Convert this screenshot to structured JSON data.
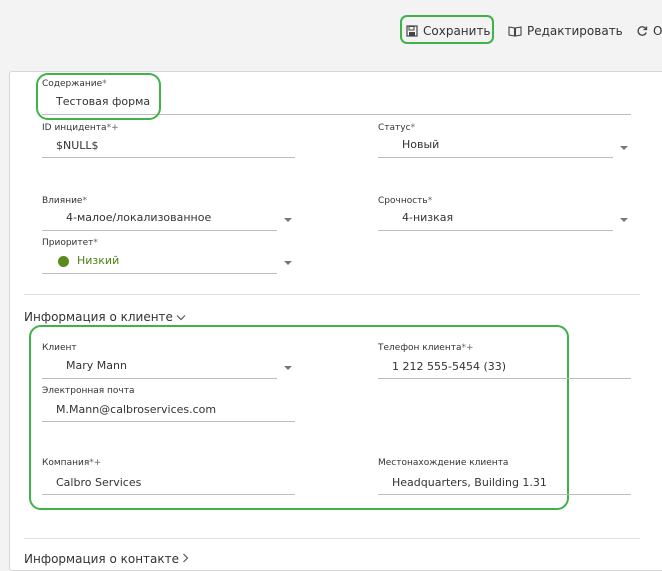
{
  "toolbar": {
    "save_label": "Сохранить",
    "edit_label": "Редактировать",
    "refresh_label": "О"
  },
  "form": {
    "summary": {
      "label": "Содержание",
      "value": "Тестовая форма"
    },
    "incident_id": {
      "label": "ID инцидента",
      "value": "$NULL$"
    },
    "status": {
      "label": "Статус",
      "value": "Новый"
    },
    "impact": {
      "label": "Влияние",
      "value": "4-малое/локализованное"
    },
    "urgency": {
      "label": "Срочность",
      "value": "4-низкая"
    },
    "priority": {
      "label": "Приоритет",
      "value": "Низкий",
      "color": "#5b8a1c"
    }
  },
  "client_section": {
    "title": "Информация о клиенте",
    "client": {
      "label": "Клиент",
      "value": "Mary Mann"
    },
    "phone": {
      "label": "Телефон клиента",
      "value": "1 212 555-5454 (33)"
    },
    "email": {
      "label": "Электронная почта",
      "value": "M.Mann@calbroservices.com"
    },
    "company": {
      "label": "Компания",
      "value": "Calbro Services"
    },
    "location": {
      "label": "Местонахождение клиента",
      "value": "Headquarters, Building 1.31"
    }
  },
  "contact_section": {
    "title": "Информация о контакте"
  },
  "required_mark": "*",
  "plus_mark": "+",
  "colors": {
    "accent_highlight": "#3fb24a",
    "priority_green": "#5b8a1c"
  }
}
